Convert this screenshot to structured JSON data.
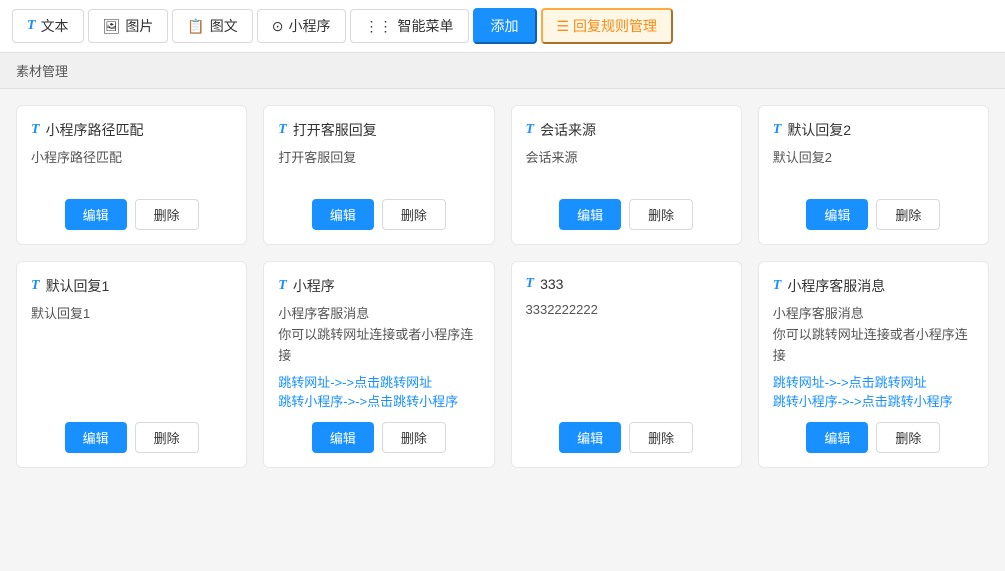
{
  "toolbar": {
    "tabs": [
      {
        "id": "text",
        "label": "文本",
        "icon": "T",
        "active": false
      },
      {
        "id": "image",
        "label": "图片",
        "icon": "🖼",
        "active": false
      },
      {
        "id": "imagetext",
        "label": "图文",
        "icon": "📋",
        "active": false
      },
      {
        "id": "miniprogram",
        "label": "小程序",
        "icon": "⊙",
        "active": false
      },
      {
        "id": "smartmenu",
        "label": "智能菜单",
        "icon": "⋮⋮",
        "active": false
      }
    ],
    "add_label": "添加",
    "manage_label": "回复规则管理"
  },
  "section": {
    "label": "素材管理"
  },
  "cards": [
    {
      "id": "card1",
      "title": "小程序路径匹配",
      "body": "小程序路径匹配",
      "links": []
    },
    {
      "id": "card2",
      "title": "打开客服回复",
      "body": "打开客服回复",
      "links": []
    },
    {
      "id": "card3",
      "title": "会话来源",
      "body": "会话来源",
      "links": []
    },
    {
      "id": "card4",
      "title": "默认回复2",
      "body": "默认回复2",
      "links": []
    },
    {
      "id": "card5",
      "title": "默认回复1",
      "body": "默认回复1",
      "links": []
    },
    {
      "id": "card6",
      "title": "小程序",
      "body": "小程序客服消息\n你可以跳转网址连接或者小程序连接",
      "links": [
        {
          "label": "跳转网址->->点击跳转网址"
        },
        {
          "label": "跳转小程序->->点击跳转小程序"
        }
      ]
    },
    {
      "id": "card7",
      "title": "333",
      "body": "3332222222",
      "links": []
    },
    {
      "id": "card8",
      "title": "小程序客服消息",
      "body": "小程序客服消息\n你可以跳转网址连接或者小程序连接",
      "links": [
        {
          "label": "跳转网址->->点击跳转网址"
        },
        {
          "label": "跳转小程序->->点击跳转小程序"
        }
      ]
    }
  ],
  "buttons": {
    "edit": "编辑",
    "delete": "删除"
  }
}
